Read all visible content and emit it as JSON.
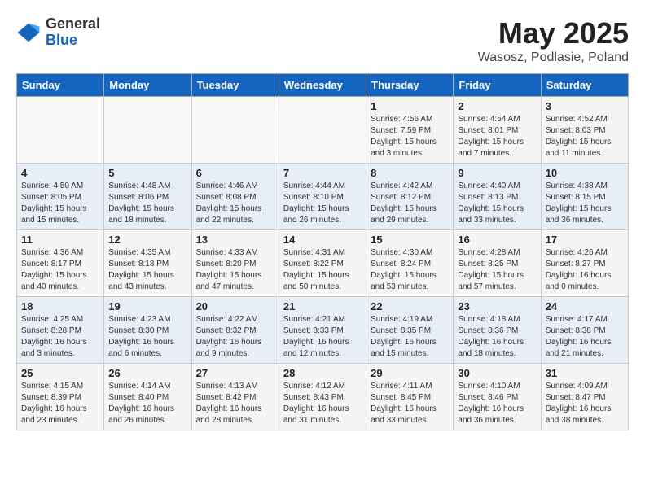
{
  "header": {
    "logo_general": "General",
    "logo_blue": "Blue",
    "month_title": "May 2025",
    "subtitle": "Wasosz, Podlasie, Poland"
  },
  "days_of_week": [
    "Sunday",
    "Monday",
    "Tuesday",
    "Wednesday",
    "Thursday",
    "Friday",
    "Saturday"
  ],
  "weeks": [
    [
      {
        "day": "",
        "info": ""
      },
      {
        "day": "",
        "info": ""
      },
      {
        "day": "",
        "info": ""
      },
      {
        "day": "",
        "info": ""
      },
      {
        "day": "1",
        "info": "Sunrise: 4:56 AM\nSunset: 7:59 PM\nDaylight: 15 hours\nand 3 minutes."
      },
      {
        "day": "2",
        "info": "Sunrise: 4:54 AM\nSunset: 8:01 PM\nDaylight: 15 hours\nand 7 minutes."
      },
      {
        "day": "3",
        "info": "Sunrise: 4:52 AM\nSunset: 8:03 PM\nDaylight: 15 hours\nand 11 minutes."
      }
    ],
    [
      {
        "day": "4",
        "info": "Sunrise: 4:50 AM\nSunset: 8:05 PM\nDaylight: 15 hours\nand 15 minutes."
      },
      {
        "day": "5",
        "info": "Sunrise: 4:48 AM\nSunset: 8:06 PM\nDaylight: 15 hours\nand 18 minutes."
      },
      {
        "day": "6",
        "info": "Sunrise: 4:46 AM\nSunset: 8:08 PM\nDaylight: 15 hours\nand 22 minutes."
      },
      {
        "day": "7",
        "info": "Sunrise: 4:44 AM\nSunset: 8:10 PM\nDaylight: 15 hours\nand 26 minutes."
      },
      {
        "day": "8",
        "info": "Sunrise: 4:42 AM\nSunset: 8:12 PM\nDaylight: 15 hours\nand 29 minutes."
      },
      {
        "day": "9",
        "info": "Sunrise: 4:40 AM\nSunset: 8:13 PM\nDaylight: 15 hours\nand 33 minutes."
      },
      {
        "day": "10",
        "info": "Sunrise: 4:38 AM\nSunset: 8:15 PM\nDaylight: 15 hours\nand 36 minutes."
      }
    ],
    [
      {
        "day": "11",
        "info": "Sunrise: 4:36 AM\nSunset: 8:17 PM\nDaylight: 15 hours\nand 40 minutes."
      },
      {
        "day": "12",
        "info": "Sunrise: 4:35 AM\nSunset: 8:18 PM\nDaylight: 15 hours\nand 43 minutes."
      },
      {
        "day": "13",
        "info": "Sunrise: 4:33 AM\nSunset: 8:20 PM\nDaylight: 15 hours\nand 47 minutes."
      },
      {
        "day": "14",
        "info": "Sunrise: 4:31 AM\nSunset: 8:22 PM\nDaylight: 15 hours\nand 50 minutes."
      },
      {
        "day": "15",
        "info": "Sunrise: 4:30 AM\nSunset: 8:24 PM\nDaylight: 15 hours\nand 53 minutes."
      },
      {
        "day": "16",
        "info": "Sunrise: 4:28 AM\nSunset: 8:25 PM\nDaylight: 15 hours\nand 57 minutes."
      },
      {
        "day": "17",
        "info": "Sunrise: 4:26 AM\nSunset: 8:27 PM\nDaylight: 16 hours\nand 0 minutes."
      }
    ],
    [
      {
        "day": "18",
        "info": "Sunrise: 4:25 AM\nSunset: 8:28 PM\nDaylight: 16 hours\nand 3 minutes."
      },
      {
        "day": "19",
        "info": "Sunrise: 4:23 AM\nSunset: 8:30 PM\nDaylight: 16 hours\nand 6 minutes."
      },
      {
        "day": "20",
        "info": "Sunrise: 4:22 AM\nSunset: 8:32 PM\nDaylight: 16 hours\nand 9 minutes."
      },
      {
        "day": "21",
        "info": "Sunrise: 4:21 AM\nSunset: 8:33 PM\nDaylight: 16 hours\nand 12 minutes."
      },
      {
        "day": "22",
        "info": "Sunrise: 4:19 AM\nSunset: 8:35 PM\nDaylight: 16 hours\nand 15 minutes."
      },
      {
        "day": "23",
        "info": "Sunrise: 4:18 AM\nSunset: 8:36 PM\nDaylight: 16 hours\nand 18 minutes."
      },
      {
        "day": "24",
        "info": "Sunrise: 4:17 AM\nSunset: 8:38 PM\nDaylight: 16 hours\nand 21 minutes."
      }
    ],
    [
      {
        "day": "25",
        "info": "Sunrise: 4:15 AM\nSunset: 8:39 PM\nDaylight: 16 hours\nand 23 minutes."
      },
      {
        "day": "26",
        "info": "Sunrise: 4:14 AM\nSunset: 8:40 PM\nDaylight: 16 hours\nand 26 minutes."
      },
      {
        "day": "27",
        "info": "Sunrise: 4:13 AM\nSunset: 8:42 PM\nDaylight: 16 hours\nand 28 minutes."
      },
      {
        "day": "28",
        "info": "Sunrise: 4:12 AM\nSunset: 8:43 PM\nDaylight: 16 hours\nand 31 minutes."
      },
      {
        "day": "29",
        "info": "Sunrise: 4:11 AM\nSunset: 8:45 PM\nDaylight: 16 hours\nand 33 minutes."
      },
      {
        "day": "30",
        "info": "Sunrise: 4:10 AM\nSunset: 8:46 PM\nDaylight: 16 hours\nand 36 minutes."
      },
      {
        "day": "31",
        "info": "Sunrise: 4:09 AM\nSunset: 8:47 PM\nDaylight: 16 hours\nand 38 minutes."
      }
    ]
  ]
}
